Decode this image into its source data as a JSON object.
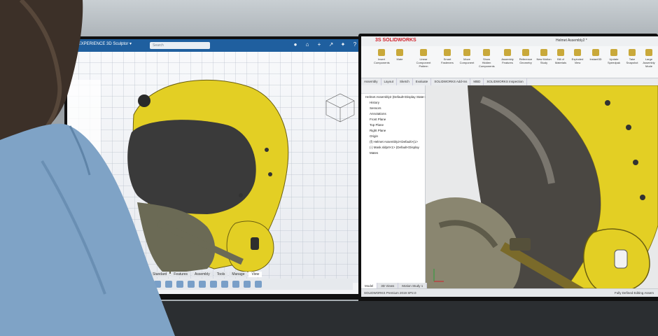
{
  "left_app": {
    "brand": "3DEXPERIENCE 3D Sculptor ▾",
    "search_placeholder": "Search",
    "bottom_tabs": [
      "Standard",
      "Features",
      "Assembly",
      "Tools",
      "Manage",
      "View"
    ],
    "active_tab": "View"
  },
  "right_app": {
    "logo": "3S SOLIDWORKS",
    "window_title": "Helmet Assembly2 *",
    "ribbon": [
      {
        "label": "Insert Components"
      },
      {
        "label": "Mate"
      },
      {
        "label": "Linear Component Pattern"
      },
      {
        "label": "Smart Fasteners"
      },
      {
        "label": "Move Component"
      },
      {
        "label": "Show Hidden Components"
      },
      {
        "label": "Assembly Features"
      },
      {
        "label": "Reference Geometry"
      },
      {
        "label": "New Motion Study"
      },
      {
        "label": "Bill of Materials"
      },
      {
        "label": "Exploded View"
      },
      {
        "label": "Instant3D"
      },
      {
        "label": "Update Speedpak"
      },
      {
        "label": "Take Snapshot"
      },
      {
        "label": "Large Assembly Mode"
      }
    ],
    "tabs": [
      "Assembly",
      "Layout",
      "Sketch",
      "Evaluate",
      "SOLIDWORKS Add-Ins",
      "MBD",
      "SOLIDWORKS Inspection"
    ],
    "tree": [
      {
        "label": "Helmet Assembly2 (Default<Display State-1>)",
        "level": 0
      },
      {
        "label": "History",
        "level": 1
      },
      {
        "label": "Sensors",
        "level": 1
      },
      {
        "label": "Annotations",
        "level": 1
      },
      {
        "label": "Front Plane",
        "level": 1
      },
      {
        "label": "Top Plane",
        "level": 1
      },
      {
        "label": "Right Plane",
        "level": 1
      },
      {
        "label": "Origin",
        "level": 1
      },
      {
        "label": "(f) Helmet Assembly2<Default>(1>",
        "level": 1
      },
      {
        "label": "(-) Mask.sldprt<1> (Default<Display",
        "level": 1
      },
      {
        "label": "Mates",
        "level": 1
      }
    ],
    "bottom_tabs": [
      "Model",
      "3D Views",
      "Motion Study 1"
    ],
    "active_bottom_tab": "Model",
    "status_left": "SOLIDWORKS Premium 2019 SP2.0",
    "status_right": "Fully Defined     Editing Assem"
  },
  "colors": {
    "helmet_yellow": "#e3cf24",
    "visor_dark": "#3a3a3a",
    "mask_olive": "#6b6a55",
    "shirt_blue": "#7fa3c6",
    "hair_brown": "#3c3028",
    "brand_blue": "#1f5f9f",
    "sw_red": "#d0202a"
  }
}
